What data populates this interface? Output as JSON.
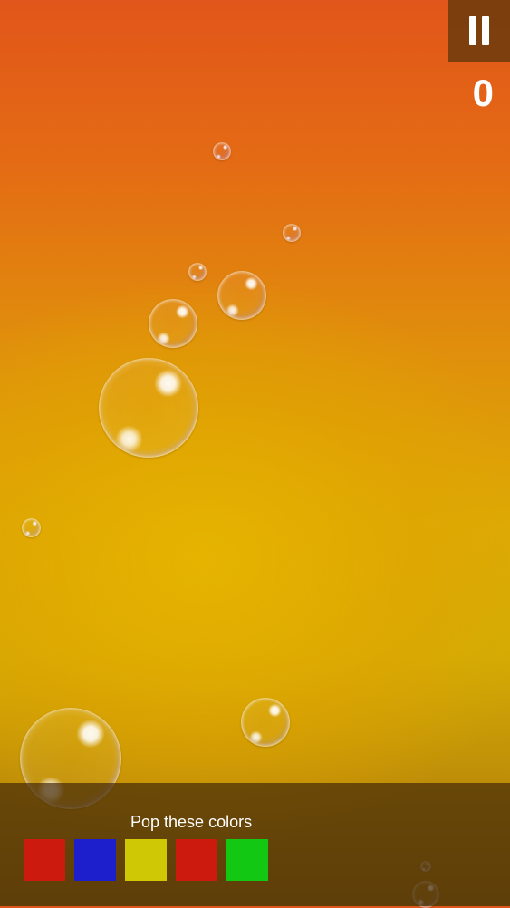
{
  "hud": {
    "pause_icon": "pause-icon",
    "score": "0"
  },
  "target_panel": {
    "title": "Pop these colors",
    "swatches": [
      {
        "name": "red",
        "color": "#cc1a0e"
      },
      {
        "name": "blue",
        "color": "#1d1fcc"
      },
      {
        "name": "yellow",
        "color": "#cfc804"
      },
      {
        "name": "red",
        "color": "#cc1a0e"
      },
      {
        "name": "green",
        "color": "#12c812"
      }
    ]
  },
  "background": {
    "top_color": "#e1561a",
    "middle_color": "#dcaa05",
    "bottom_color": "#9c6e0b"
  }
}
